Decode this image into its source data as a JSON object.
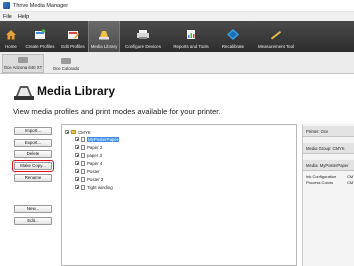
{
  "window": {
    "title": "Thrive Media Manager"
  },
  "menu": [
    "File",
    "Help"
  ],
  "ribbon": [
    {
      "label": "Home",
      "icon": "home-icon"
    },
    {
      "label": "Create Profiles",
      "icon": "create-profiles-icon"
    },
    {
      "label": "Edit Profiles",
      "icon": "edit-profiles-icon"
    },
    {
      "label": "Media Library",
      "icon": "media-library-icon"
    },
    {
      "label": "Configure Devices",
      "icon": "printer-icon"
    },
    {
      "label": "Reports and Tools",
      "icon": "reports-icon"
    },
    {
      "label": "Recalibrate",
      "icon": "recalibrate-icon"
    },
    {
      "label": "Measurement Tool",
      "icon": "measurement-icon"
    }
  ],
  "doc_tabs": [
    "Oce Arizona 640 XT",
    "Oce Colorado"
  ],
  "page": {
    "title": "Media Library",
    "subtitle": "View media profiles and print modes available for your printer."
  },
  "buttons": {
    "import": "Import...",
    "export": "Export...",
    "delete": "Delete",
    "make_copy": "Make Copy...",
    "rename": "Rename",
    "new": "New...",
    "edit": "Edit..."
  },
  "tree": {
    "root": "CMYK",
    "items": [
      "MyPosterPaper",
      "Paper 2",
      "paper 3",
      "Paper 4",
      "Poster",
      "Poster 2",
      "Tight winding"
    ],
    "selected_index": 0
  },
  "info": {
    "printer": "Printer: Oce",
    "media_group": "Media Group: CMYK",
    "media": "Media: MyPosterPaper",
    "ink_config_label": "Ink Configuration",
    "ink_config_value": "CM",
    "process_colors_label": "Process Colors",
    "process_colors_value": "CM"
  }
}
